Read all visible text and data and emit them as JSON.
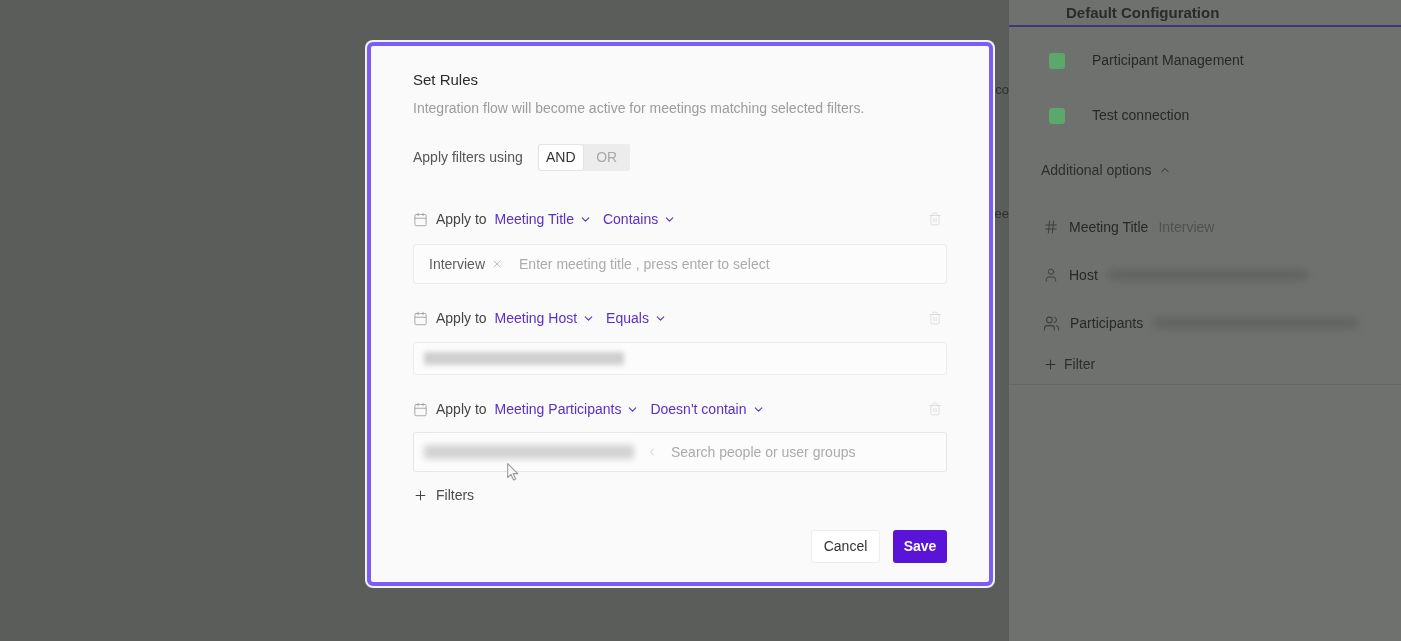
{
  "background": {
    "fragments": [
      "co",
      "ee"
    ]
  },
  "side_panel": {
    "header": "Default Configuration",
    "steps": [
      {
        "label": "Participant Management",
        "done": true
      },
      {
        "label": "Test connection",
        "done": true
      }
    ],
    "additional_options": {
      "label": "Additional options",
      "expanded": true
    },
    "filters": [
      {
        "kind": "title",
        "label": "Meeting Title",
        "value": "Interview"
      },
      {
        "kind": "host",
        "label": "Host"
      },
      {
        "kind": "participants",
        "label": "Participants"
      }
    ],
    "add_filter": "Filter"
  },
  "dialog": {
    "title": "Set Rules",
    "description": "Integration flow will become active for meetings matching selected filters.",
    "logic": {
      "label": "Apply filters using",
      "options": [
        {
          "label": "AND",
          "selected": true
        },
        {
          "label": "OR",
          "selected": false
        }
      ]
    },
    "rules": [
      {
        "prefix": "Apply to",
        "field": "Meeting Title",
        "operator": "Contains",
        "input": {
          "kind": "tags",
          "tags": [
            "Interview"
          ],
          "placeholder": "Enter meeting title , press enter to select"
        }
      },
      {
        "prefix": "Apply to",
        "field": "Meeting Host",
        "operator": "Equals",
        "input": {
          "kind": "redacted"
        }
      },
      {
        "prefix": "Apply to",
        "field": "Meeting Participants",
        "operator": "Doesn't contain",
        "input": {
          "kind": "people",
          "placeholder": "Search people or user groups"
        }
      }
    ],
    "add_filter": "Filters",
    "buttons": [
      {
        "label": "Cancel",
        "kind": "secondary"
      },
      {
        "label": "Save",
        "kind": "primary"
      }
    ]
  }
}
